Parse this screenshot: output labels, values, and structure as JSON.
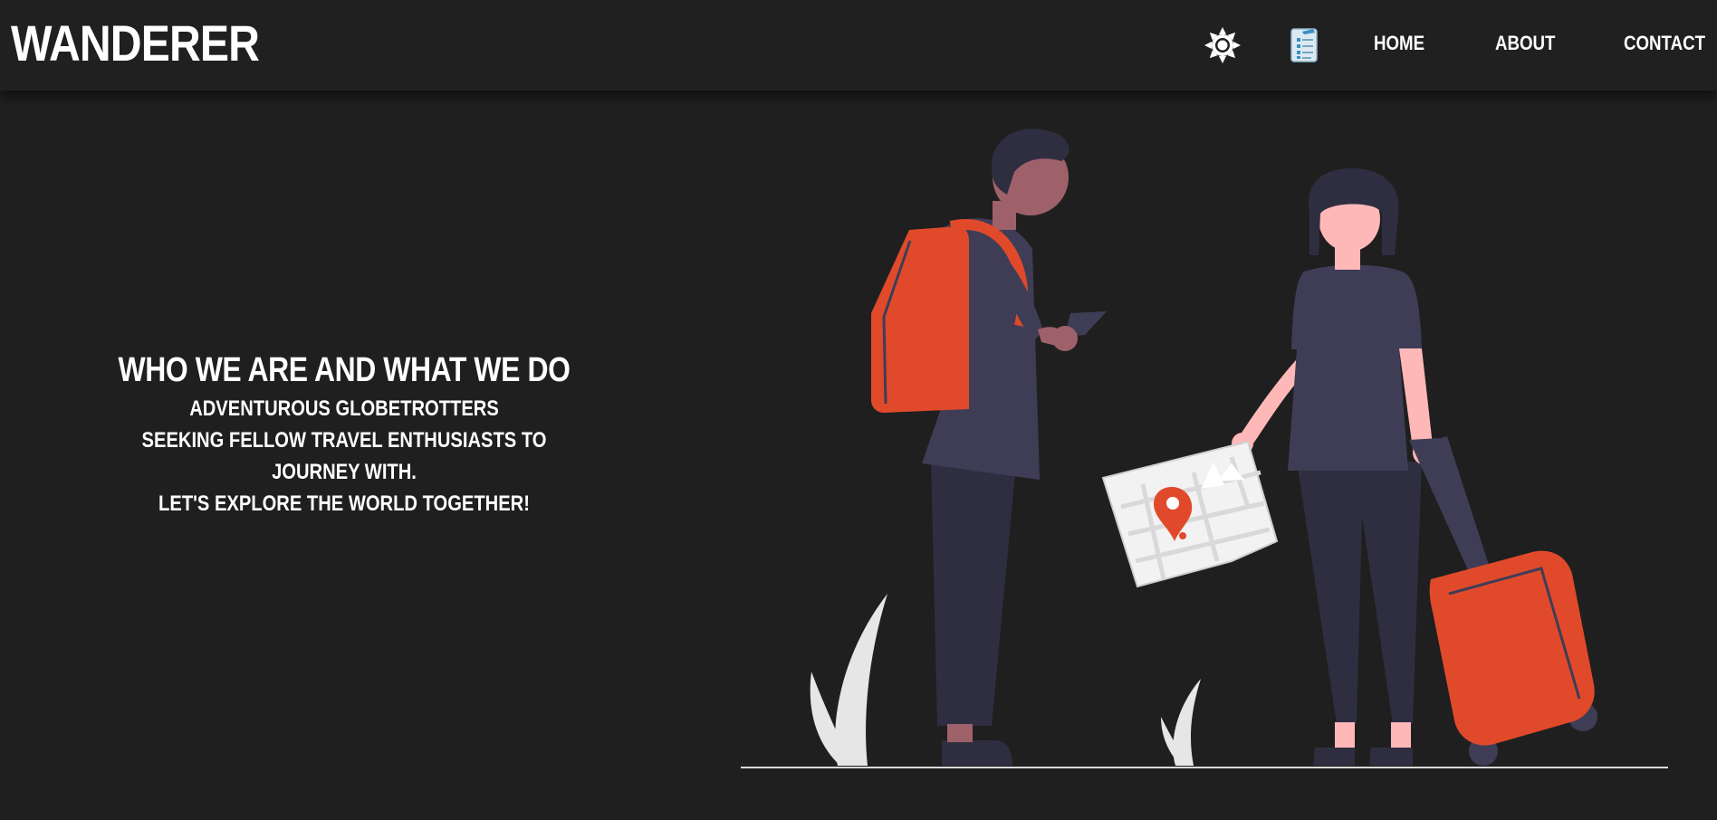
{
  "header": {
    "brand": "WANDERER",
    "theme_icon": "sun-icon",
    "itinerary_icon": "travel-checklist-icon",
    "nav": [
      {
        "label": "HOME"
      },
      {
        "label": "ABOUT"
      },
      {
        "label": "CONTACT"
      }
    ]
  },
  "hero": {
    "title": "WHO WE ARE AND WHAT WE DO",
    "lines": [
      "ADVENTUROUS GLOBETROTTERS",
      "SEEKING FELLOW TRAVEL ENTHUSIASTS TO JOURNEY WITH.",
      "LET'S EXPLORE THE WORLD TOGETHER!"
    ]
  },
  "colors": {
    "background": "#1f1f1f",
    "navbar": "#202020",
    "accent_orange": "#e04a2b",
    "clothing_dark": "#3f3d56",
    "text": "#ffffff"
  }
}
